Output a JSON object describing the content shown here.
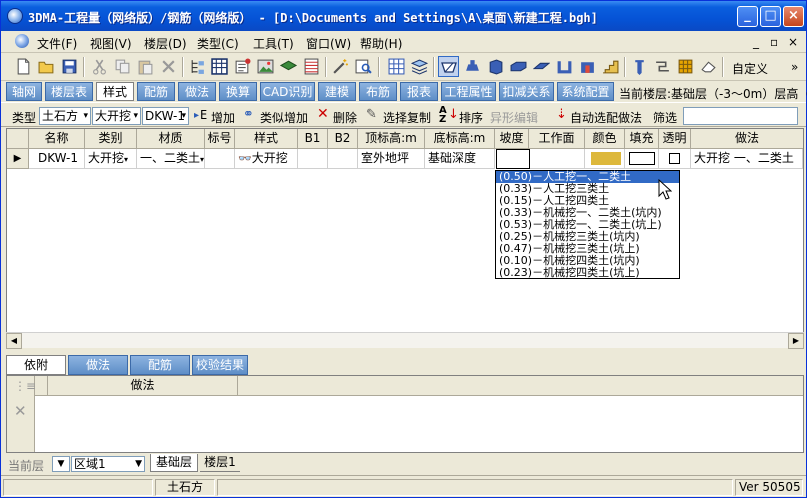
{
  "window": {
    "title": "3DMA-工程量（网络版）/钢筋（网络版） - [D:\\Documents and Settings\\A\\桌面\\新建工程.bgh]"
  },
  "menu": {
    "items": [
      "文件(F)",
      "视图(V)",
      "楼层(D)",
      "类型(C)",
      "工具(T)",
      "窗口(W)",
      "帮助(H)"
    ],
    "mdi_controls": [
      "_",
      "▫",
      "×"
    ]
  },
  "toolbar": {
    "custom_label": "自定义",
    "more": "»"
  },
  "module_tabs": {
    "items": [
      "轴网",
      "楼层表",
      "样式",
      "配筋",
      "做法",
      "换算",
      "CAD识别",
      "建模",
      "布筋",
      "报表",
      "工程属性",
      "扣减关系",
      "系统配置"
    ],
    "active_index": 2
  },
  "current_floor": "当前楼层:基础层（-3～0m）层高（3m",
  "command_bar": {
    "type_label": "类型",
    "type_value": "土石方",
    "subtype_value": "大开挖",
    "code_value": "DKW-1",
    "add": "增加",
    "similar_add": "类似增加",
    "delete": "删除",
    "select_copy": "选择复制",
    "sort": "排序",
    "shape_edit": "异形编辑",
    "auto_method": "自动选配做法",
    "filter": "筛选",
    "filter_value": ""
  },
  "grid": {
    "columns": [
      "名称",
      "类别",
      "材质",
      "标号",
      "样式",
      "B1",
      "B2",
      "顶标高:m",
      "底标高:m",
      "坡度",
      "工作面",
      "颜色",
      "填充",
      "透明",
      "做法"
    ],
    "rows": [
      {
        "name": "DKW-1",
        "category": "大开挖",
        "material": "一、二类土",
        "grade": "",
        "style": "大开挖",
        "b1": "",
        "b2": "",
        "top": "室外地坪",
        "bottom": "基础深度",
        "slope": "",
        "workface": "",
        "color_hex": "#ddb83c",
        "fill": "",
        "transparent": false,
        "method": "大开挖 一、二类土"
      }
    ]
  },
  "slope_dropdown": {
    "options": [
      "(0.50)－人工挖一、二类土",
      "(0.33)－人工挖三类土",
      "(0.15)－人工挖四类土",
      "(0.33)－机械挖一、二类土(坑内)",
      "(0.53)－机械挖一、二类土(坑上)",
      "(0.25)－机械挖三类土(坑内)",
      "(0.47)－机械挖三类土(坑上)",
      "(0.10)－机械挖四类土(坑内)",
      "(0.23)－机械挖四类土(坑上)"
    ],
    "selected_index": 0
  },
  "bottom_tabs": {
    "items": [
      "依附",
      "做法",
      "配筋",
      "校验结果"
    ],
    "active_index": 0,
    "method_header": "做法"
  },
  "floor_bar": {
    "current_floor_label": "当前层",
    "region_value": "区域1",
    "tabs": [
      "基础层",
      "楼层1"
    ]
  },
  "status_bar": {
    "center": "土石方",
    "version": "Ver 50505"
  },
  "colors": {
    "titlebar": "#0553d6",
    "tab_blue": "#5e8ec7",
    "selection": "#316ac5",
    "material_color": "#ddb83c"
  }
}
